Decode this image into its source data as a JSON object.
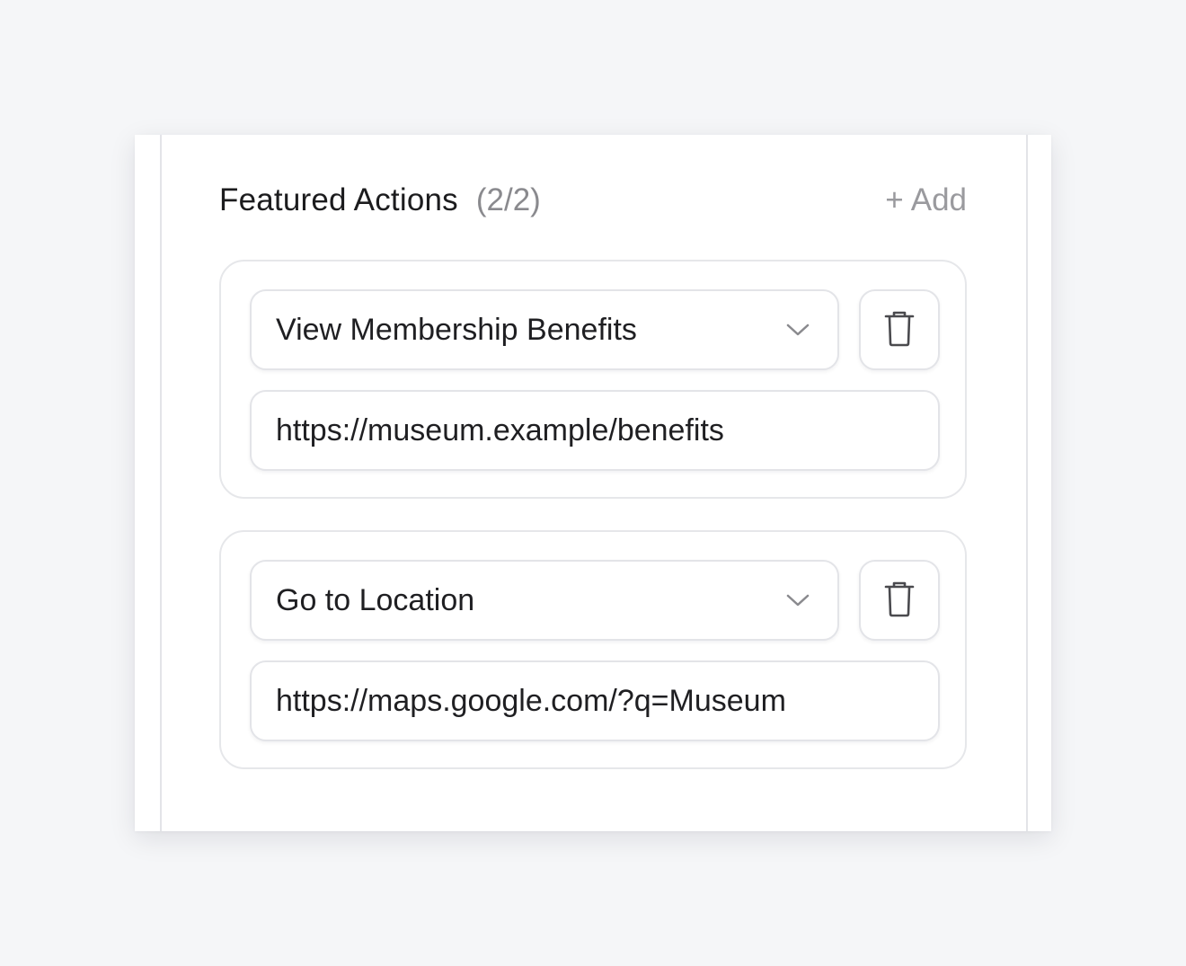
{
  "section": {
    "title": "Featured Actions",
    "count": "(2/2)",
    "add_label": "Add",
    "add_icon": "plus-icon"
  },
  "actions": [
    {
      "type": "View Membership Benefits",
      "url": "https://museum.example/benefits",
      "dropdown_icon": "chevron-down-icon",
      "delete_icon": "trash-icon"
    },
    {
      "type": "Go to Location",
      "url": "https://maps.google.com/?q=Museum",
      "dropdown_icon": "chevron-down-icon",
      "delete_icon": "trash-icon"
    }
  ],
  "colors": {
    "background": "#f5f6f8",
    "card": "#ffffff",
    "border": "#e3e4e8",
    "text": "#1f1f22",
    "muted": "#8a8a8e",
    "icon": "#4a4a4e"
  }
}
